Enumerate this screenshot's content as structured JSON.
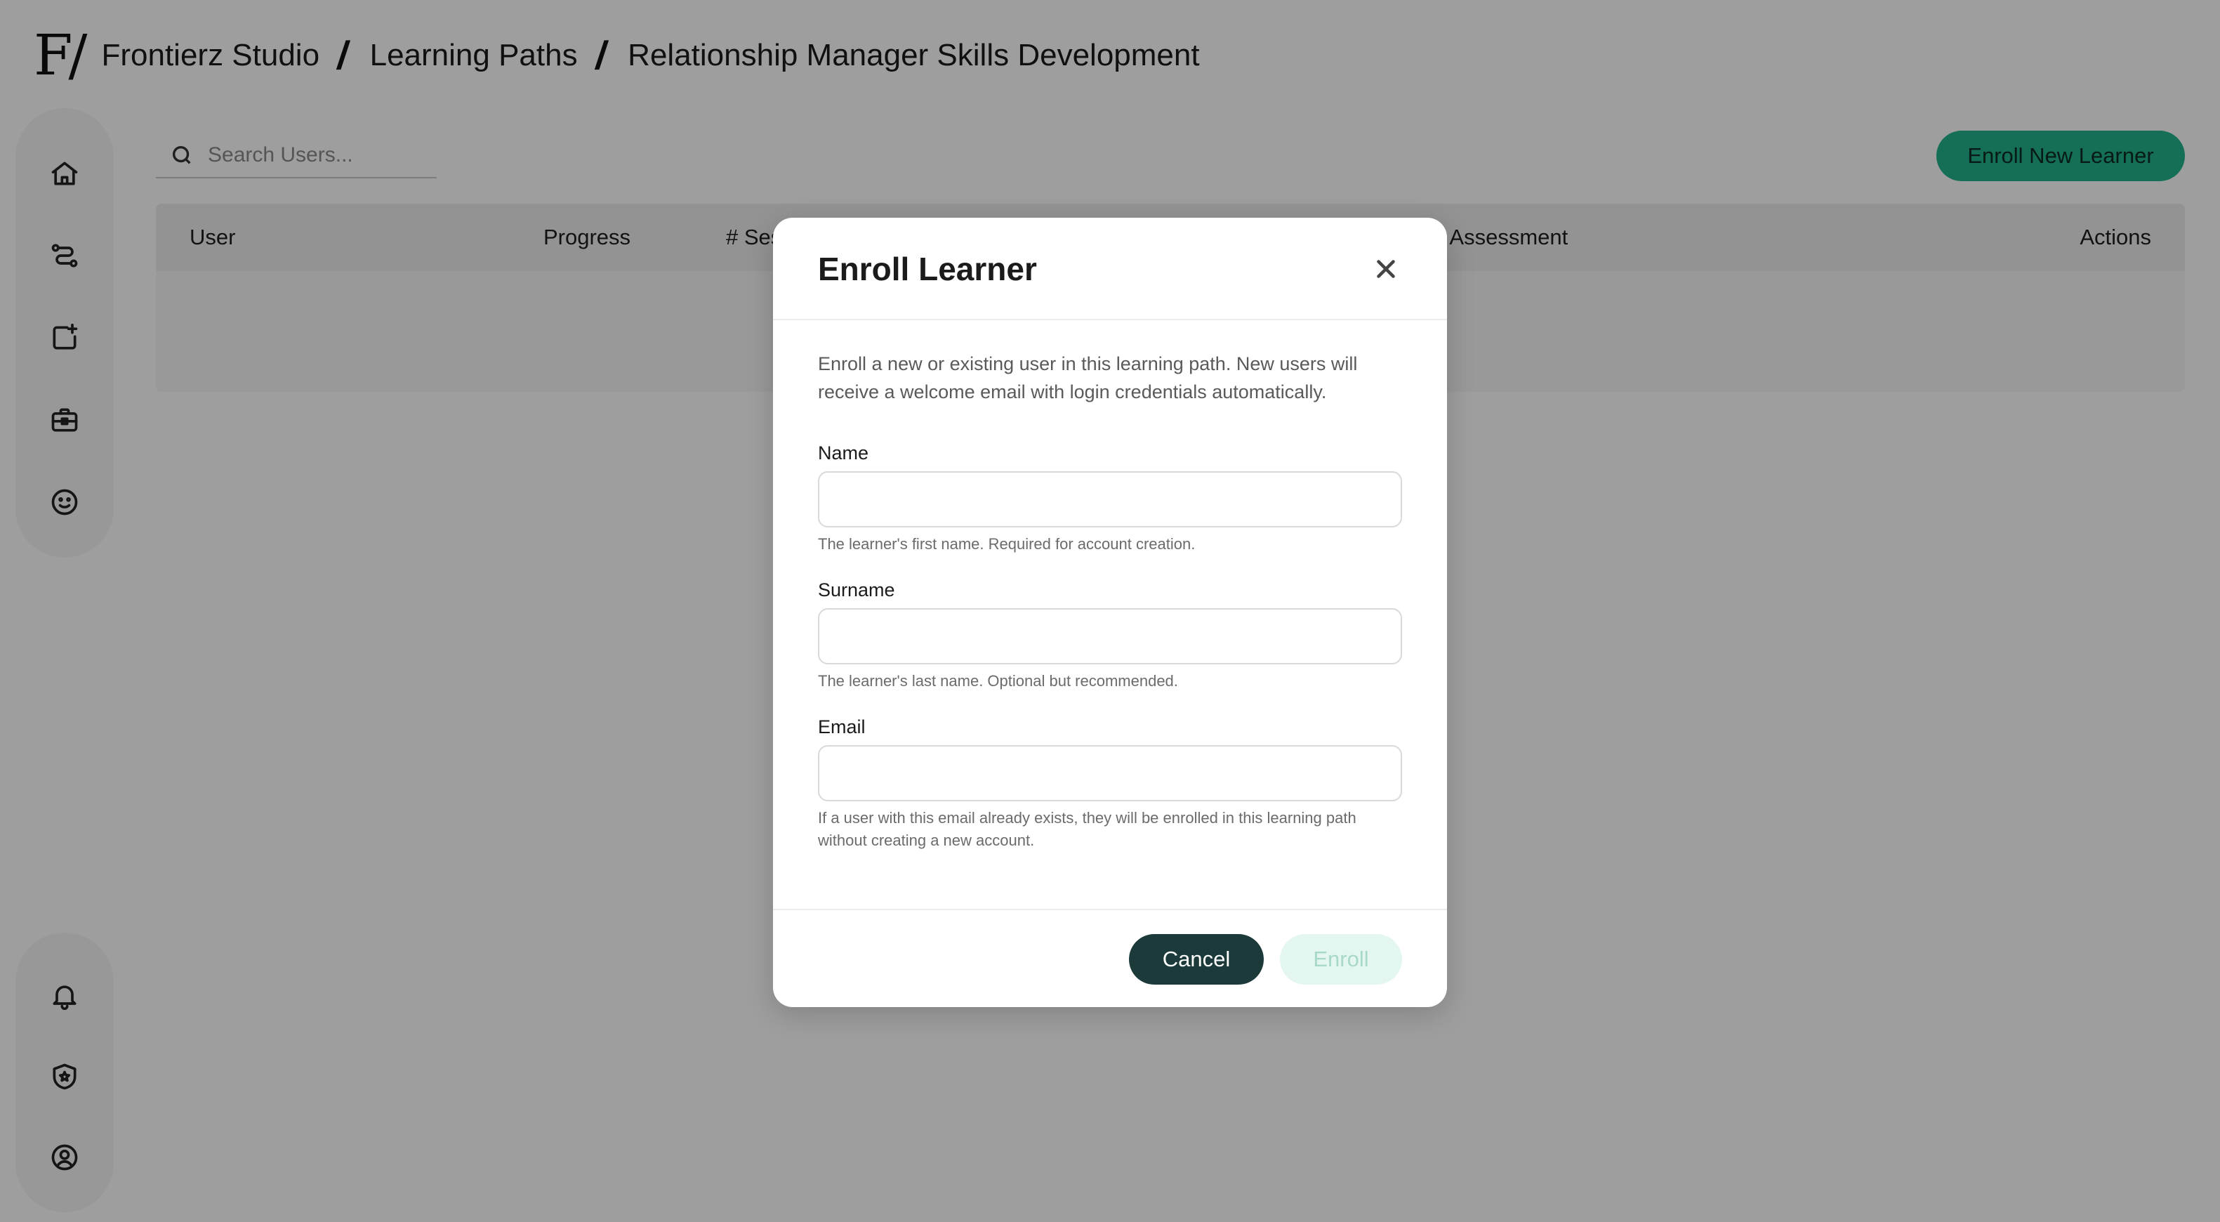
{
  "breadcrumb": {
    "logo": "F/",
    "items": [
      "Frontierz Studio",
      "Learning Paths",
      "Relationship Manager Skills Development"
    ],
    "separator": "/"
  },
  "sidebar": {
    "top_icons": [
      "home-icon",
      "path-icon",
      "add-content-icon",
      "briefcase-icon",
      "smiley-icon"
    ],
    "bottom_icons": [
      "bell-icon",
      "shield-icon",
      "user-circle-icon"
    ]
  },
  "search": {
    "placeholder": "Search Users..."
  },
  "toolbar": {
    "enroll_new_label": "Enroll New Learner"
  },
  "table": {
    "columns": [
      "User",
      "Progress",
      "# Ses",
      "s Assessment",
      "Actions"
    ]
  },
  "modal": {
    "title": "Enroll Learner",
    "description": "Enroll a new or existing user in this learning path. New users will receive a welcome email with login credentials automatically.",
    "fields": [
      {
        "label": "Name",
        "value": "",
        "help": "The learner's first name. Required for account creation."
      },
      {
        "label": "Surname",
        "value": "",
        "help": "The learner's last name. Optional but recommended."
      },
      {
        "label": "Email",
        "value": "",
        "help": "If a user with this email already exists, they will be enrolled in this learning path without creating a new account."
      }
    ],
    "cancel_label": "Cancel",
    "enroll_label": "Enroll"
  },
  "colors": {
    "accent": "#23b38b",
    "dark_button": "#1c3a3a",
    "disabled_button": "#e4f6f0",
    "overlay": "rgba(0,0,0,0.38)"
  }
}
